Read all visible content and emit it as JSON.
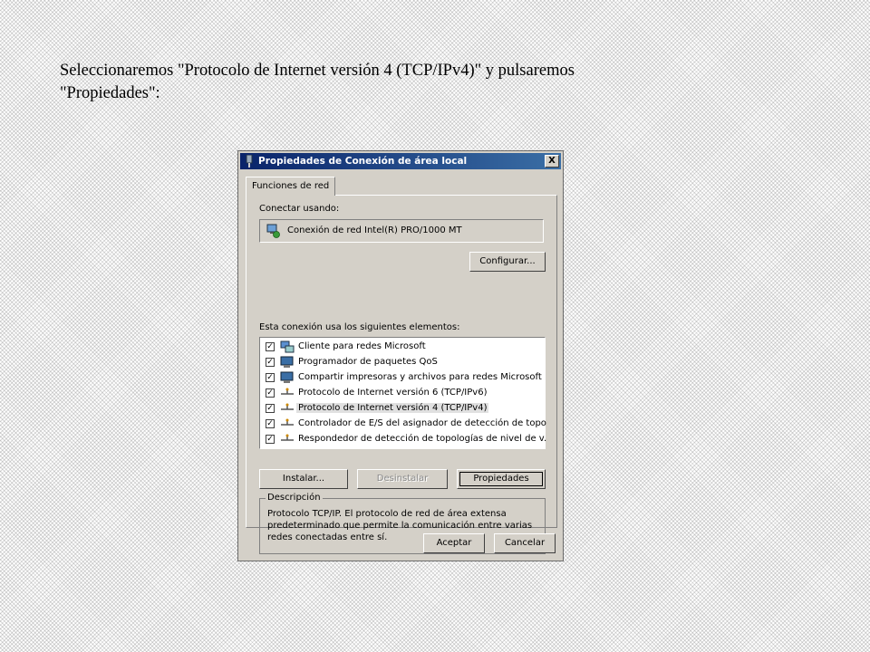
{
  "caption": {
    "line1": "Seleccionaremos \"Protocolo de Internet versión 4 (TCP/IPv4)\" y pulsaremos",
    "line2": "\"Propiedades\":"
  },
  "dialog": {
    "title": "Propiedades de Conexión de área local",
    "close_label": "X",
    "tab": "Funciones de red",
    "connect_using_label": "Conectar usando:",
    "adapter_name": "Conexión de red Intel(R) PRO/1000 MT",
    "configure_button": "Configurar...",
    "items_label": "Esta conexión usa los siguientes elementos:",
    "items": [
      {
        "label": "Cliente para redes Microsoft",
        "icon": "network-client-icon",
        "checked": true,
        "selected": false
      },
      {
        "label": "Programador de paquetes QoS",
        "icon": "network-service-icon",
        "checked": true,
        "selected": false
      },
      {
        "label": "Compartir impresoras y archivos para redes Microsoft",
        "icon": "file-sharing-icon",
        "checked": true,
        "selected": false
      },
      {
        "label": "Protocolo de Internet versión 6 (TCP/IPv6)",
        "icon": "protocol-icon",
        "checked": true,
        "selected": false
      },
      {
        "label": "Protocolo de Internet versión 4 (TCP/IPv4)",
        "icon": "protocol-icon",
        "checked": true,
        "selected": true
      },
      {
        "label": "Controlador de E/S del asignador de detección de topol...",
        "icon": "protocol-icon",
        "checked": true,
        "selected": false
      },
      {
        "label": "Respondedor de detección de topologías de nivel de v...",
        "icon": "protocol-icon",
        "checked": true,
        "selected": false
      }
    ],
    "install_button": "Instalar...",
    "uninstall_button": "Desinstalar",
    "properties_button": "Propiedades",
    "description_title": "Descripción",
    "description_text": "Protocolo TCP/IP. El protocolo de red de área extensa predeterminado que permite la comunicación entre varias redes conectadas entre sí.",
    "ok_button": "Aceptar",
    "cancel_button": "Cancelar"
  },
  "colors": {
    "titlebar_start": "#0a246a",
    "titlebar_end": "#3a6ea5",
    "dialog_face": "#d4d0c8"
  }
}
